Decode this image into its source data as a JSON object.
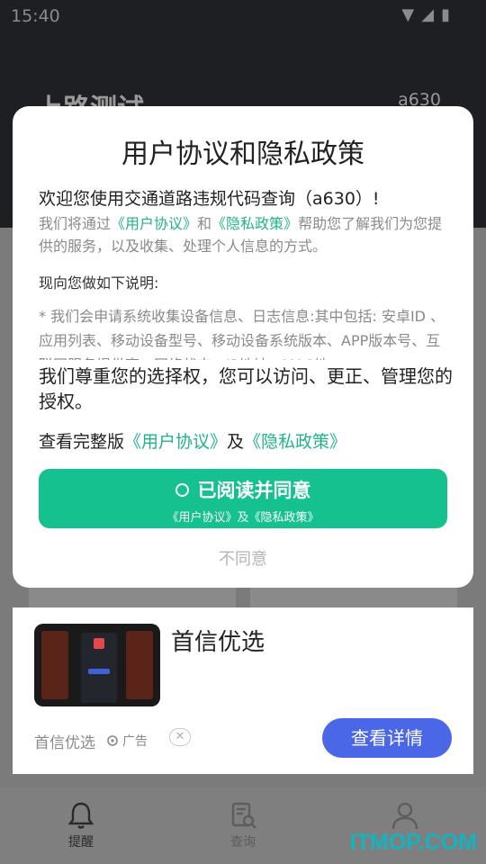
{
  "status_bar": {
    "time": "15:40"
  },
  "app": {
    "title": "上路测试",
    "code": "a630"
  },
  "dialog": {
    "title": "用户协议和隐私政策",
    "welcome": "欢迎您使用交通道路违规代码查询（a630）!",
    "intro_before": "我们将通过",
    "intro_user_agreement": "《用户协议》",
    "intro_and": "和",
    "intro_privacy": "《隐私政策》",
    "intro_after": "帮助您了解我们为您提供的服务，以及收集、处理个人信息的方式。",
    "subhead": "现向您做如下说明:",
    "detail": "* 我们会申请系统收集设备信息、日志信息:其中包括: 安卓ID 、应用列表、移动设备型号、移动设备系统版本、APP版本号、互联网服务提供商、网络状态、IP地址、MAC地",
    "respect": "我们尊重您的选择权，您可以访问、更正、管理您的授权。",
    "view_prefix": "查看完整版",
    "view_user_agreement": "《用户协议》",
    "view_and": "及",
    "view_privacy": "《隐私政策》",
    "agree_label": "已阅读并同意",
    "agree_sub": "《用户协议》及《隐私政策》",
    "disagree_label": "不同意"
  },
  "ad": {
    "title": "首信优选",
    "source": "首信优选",
    "tag": "广告",
    "close": "✕",
    "cta": "查看详情"
  },
  "bottom_nav": [
    {
      "label": "提醒",
      "icon": "bell-icon",
      "active": true
    },
    {
      "label": "查询",
      "icon": "search-doc-icon",
      "active": false
    },
    {
      "label": "",
      "icon": "person-icon",
      "active": false
    }
  ],
  "watermark": "ITMOP.COM",
  "colors": {
    "accent": "#15c18e",
    "link": "#22b38b",
    "cta": "#4a67e8"
  }
}
